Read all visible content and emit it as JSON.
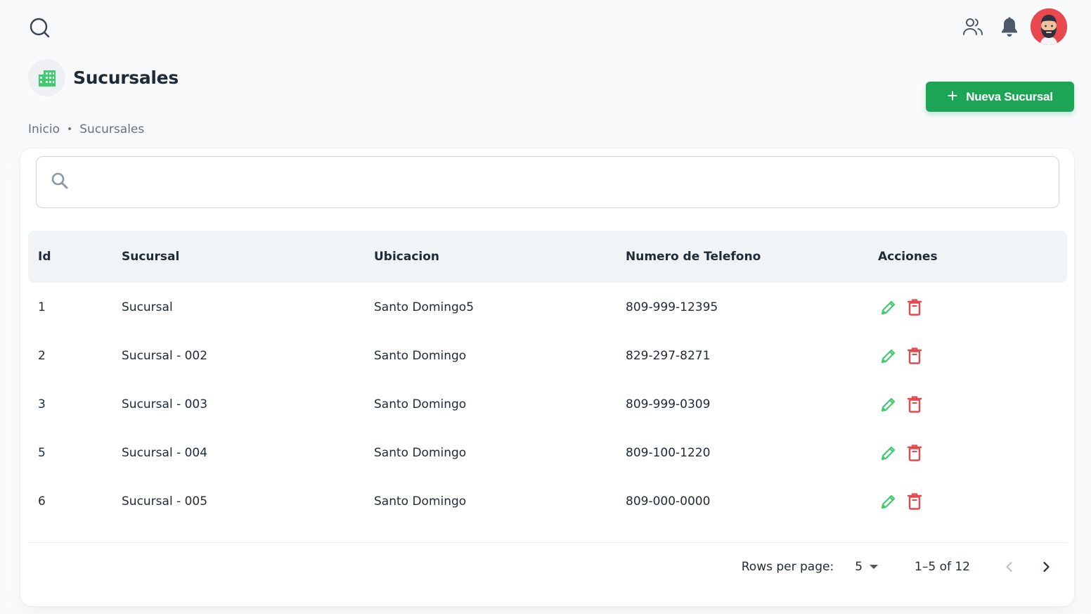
{
  "topbar": {
    "icons": [
      "search-icon",
      "users-icon",
      "bell-icon",
      "avatar"
    ]
  },
  "header": {
    "title": "Sucursales",
    "icon": "building-icon",
    "new_button_label": "Nueva Sucursal"
  },
  "breadcrumb": [
    "Inicio",
    "Sucursales"
  ],
  "search": {
    "placeholder": ""
  },
  "table": {
    "columns": [
      "Id",
      "Sucursal",
      "Ubicacion",
      "Numero de Telefono",
      "Acciones"
    ],
    "rows": [
      {
        "id": "1",
        "sucursal": "Sucursal",
        "ubicacion": "Santo Domingo5",
        "telefono": "809-999-12395"
      },
      {
        "id": "2",
        "sucursal": "Sucursal - 002",
        "ubicacion": "Santo Domingo",
        "telefono": "829-297-8271"
      },
      {
        "id": "3",
        "sucursal": "Sucursal - 003",
        "ubicacion": "Santo Domingo",
        "telefono": "809-999-0309"
      },
      {
        "id": "5",
        "sucursal": "Sucursal - 004",
        "ubicacion": "Santo Domingo",
        "telefono": "809-100-1220"
      },
      {
        "id": "6",
        "sucursal": "Sucursal - 005",
        "ubicacion": "Santo Domingo",
        "telefono": "809-000-0000"
      }
    ]
  },
  "pagination": {
    "rows_per_page_label": "Rows per page:",
    "rows_per_page_value": "5",
    "range": "1–5 of 12"
  },
  "colors": {
    "primary_green": "#1da556",
    "edit_green": "#3fcc6e",
    "delete_red": "#e5484d",
    "avatar_bg": "#e8484e"
  }
}
